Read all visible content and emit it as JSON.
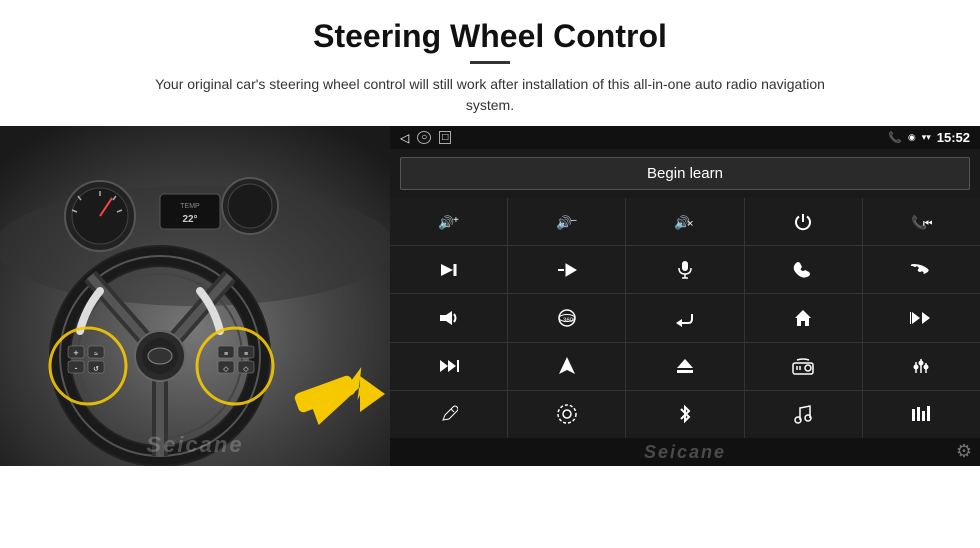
{
  "header": {
    "title": "Steering Wheel Control",
    "subtitle": "Your original car's steering wheel control will still work after installation of this all-in-one auto radio navigation system."
  },
  "android_ui": {
    "statusbar": {
      "nav_back": "◁",
      "nav_home_circle": "○",
      "nav_square": "□",
      "signal_battery": "▪▮",
      "phone_icon": "📞",
      "location_icon": "◉",
      "wifi_icon": "▾",
      "time": "15:52"
    },
    "begin_learn_label": "Begin learn",
    "controls": [
      {
        "icon": "🔊+",
        "label": "vol-up"
      },
      {
        "icon": "🔊-",
        "label": "vol-down"
      },
      {
        "icon": "🔇",
        "label": "mute"
      },
      {
        "icon": "⏻",
        "label": "power"
      },
      {
        "icon": "⏮",
        "label": "prev-track"
      },
      {
        "icon": "⏭",
        "label": "next-track"
      },
      {
        "icon": "⏩⏪",
        "label": "ff-rw"
      },
      {
        "icon": "🎤",
        "label": "mic"
      },
      {
        "icon": "📞",
        "label": "call"
      },
      {
        "icon": "↩",
        "label": "hang-up"
      },
      {
        "icon": "📢",
        "label": "horn"
      },
      {
        "icon": "360",
        "label": "360-view"
      },
      {
        "icon": "↩",
        "label": "return"
      },
      {
        "icon": "🏠",
        "label": "home"
      },
      {
        "icon": "⏮⏮",
        "label": "rewind"
      },
      {
        "icon": "⏭⏭",
        "label": "fast-fwd"
      },
      {
        "icon": "▶",
        "label": "nav"
      },
      {
        "icon": "⏏",
        "label": "eject"
      },
      {
        "icon": "📻",
        "label": "radio"
      },
      {
        "icon": "🎛",
        "label": "settings-eq"
      },
      {
        "icon": "✏",
        "label": "pen"
      },
      {
        "icon": "⚙",
        "label": "settings2"
      },
      {
        "icon": "✱",
        "label": "bluetooth"
      },
      {
        "icon": "🎵",
        "label": "music"
      },
      {
        "icon": "📊",
        "label": "equalizer"
      }
    ]
  }
}
